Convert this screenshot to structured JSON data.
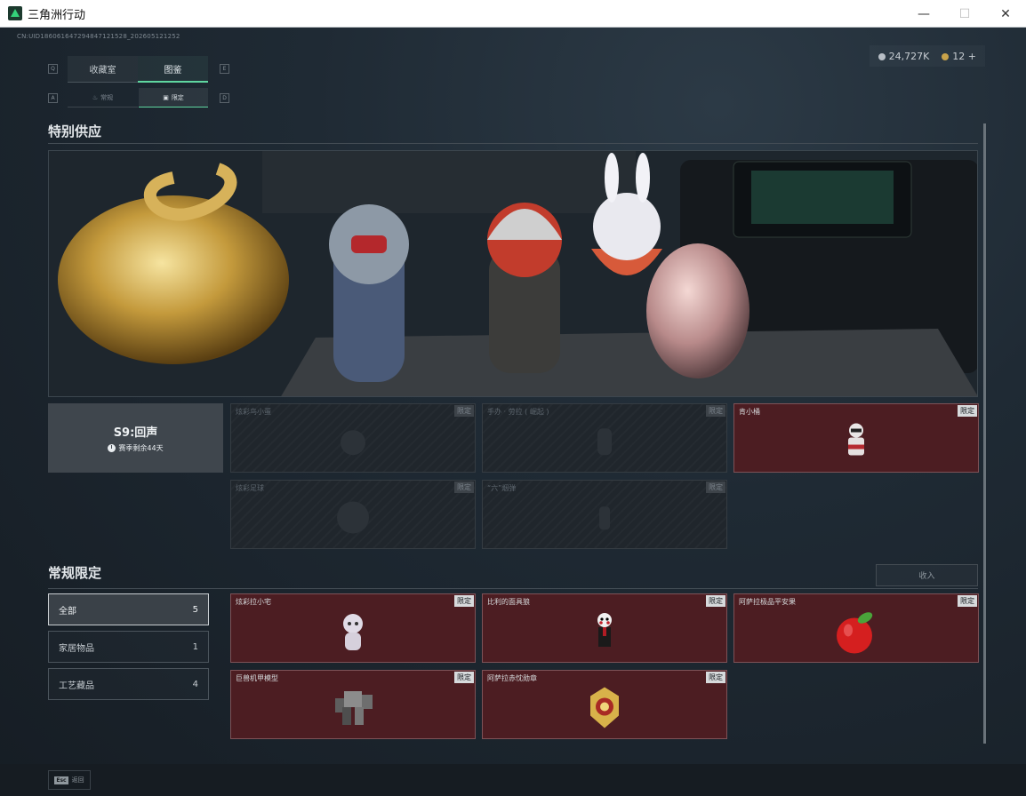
{
  "window": {
    "title": "三角洲行动",
    "minimize": "—",
    "maximize": "☐",
    "close": "✕"
  },
  "uid": "CN:UID18606164729484712152​8_202605121252",
  "currency": [
    {
      "icon": "silver-coin-icon",
      "value": "24,727K"
    },
    {
      "icon": "gold-coin-icon",
      "value": "12"
    }
  ],
  "currency_add": "+",
  "tabs": {
    "left_key": "Q",
    "right_key": "E",
    "collection": "收藏室",
    "catalog": "图鉴"
  },
  "subtabs": {
    "left_key": "A",
    "right_key": "D",
    "normal": "常规",
    "limited": "限定"
  },
  "special": {
    "title": "特别供应",
    "season_title": "S9:回声",
    "season_remain": "赛季剩余44天",
    "items": [
      {
        "name": "炫彩鸟小蛋",
        "tag": "限定",
        "owned": false,
        "icon": "bird-egg-icon"
      },
      {
        "name": "手办 · 劳拉 ( 崛起 )",
        "tag": "限定",
        "owned": false,
        "icon": "figure-icon"
      },
      {
        "name": "肯小桶",
        "tag": "限定",
        "owned": true,
        "icon": "bucket-figure-icon"
      },
      {
        "name": "炫彩足球",
        "tag": "限定",
        "owned": false,
        "icon": "football-icon"
      },
      {
        "name": "“六”烟弹",
        "tag": "限定",
        "owned": false,
        "icon": "smoke-grenade-icon"
      }
    ]
  },
  "regular": {
    "title": "常规限定",
    "collapse_label": "收入",
    "categories": [
      {
        "label": "全部",
        "count": "5"
      },
      {
        "label": "家居物品",
        "count": "1"
      },
      {
        "label": "工艺藏品",
        "count": "4"
      }
    ],
    "items": [
      {
        "name": "炫彩拉小宅",
        "tag": "限定",
        "icon": "plush-figure-icon"
      },
      {
        "name": "比利的面具狼",
        "tag": "限定",
        "icon": "puppet-icon"
      },
      {
        "name": "阿萨拉极品平安果",
        "tag": "限定",
        "icon": "apple-icon"
      },
      {
        "name": "巨兽机甲模型",
        "tag": "限定",
        "icon": "mecha-model-icon"
      },
      {
        "name": "阿萨拉赤忱勋章",
        "tag": "限定",
        "icon": "medal-icon"
      }
    ]
  },
  "footer": {
    "esc_key": "Esc",
    "back_label": "返回"
  },
  "colors": {
    "accent": "#5fd6a0",
    "owned_card": "#4c1d22"
  }
}
